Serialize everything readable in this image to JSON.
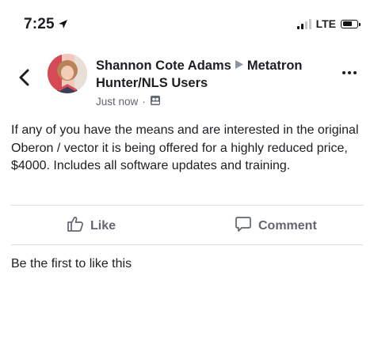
{
  "status_bar": {
    "time": "7:25",
    "location_icon": "location-arrow-icon",
    "network": "LTE",
    "signal_bars_active": 2,
    "signal_bars_total": 4,
    "battery_level": 0.7
  },
  "post": {
    "author": "Shannon Cote Adams",
    "group_arrow_icon": "group-arrow-icon",
    "group": "Metatron Hunter/NLS Users",
    "timestamp": "Just now",
    "separator": "·",
    "audience_icon": "group-audience-icon",
    "body": "If any of you have the means and are interested in the original Oberon / vector it is being offered for a highly reduced price, $4000. Includes all software updates and training.",
    "more_icon": "more-options-icon"
  },
  "actions": {
    "like_label": "Like",
    "comment_label": "Comment"
  },
  "footer": {
    "likes_text": "Be the first to like this"
  },
  "colors": {
    "text_primary": "#1c1e21",
    "text_secondary": "#606770",
    "divider": "#dadde1"
  }
}
